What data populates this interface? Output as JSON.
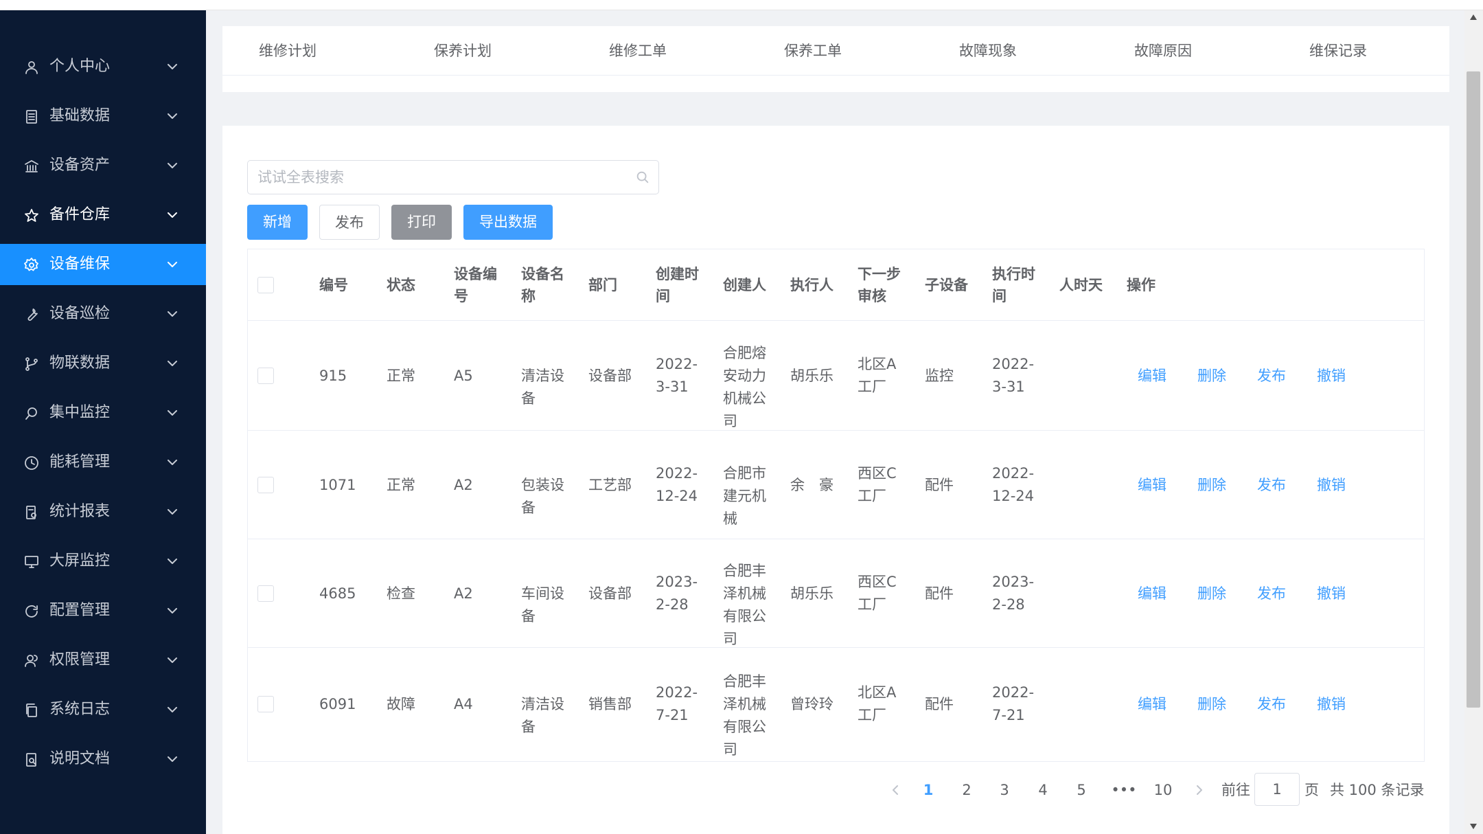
{
  "sidebar": {
    "items": [
      {
        "label": "个人中心",
        "icon": "user-icon"
      },
      {
        "label": "基础数据",
        "icon": "document-icon"
      },
      {
        "label": "设备资产",
        "icon": "bank-icon"
      },
      {
        "label": "备件仓库",
        "icon": "star-icon"
      },
      {
        "label": "设备维保",
        "icon": "gear-icon"
      },
      {
        "label": "设备巡检",
        "icon": "wrench-icon"
      },
      {
        "label": "物联数据",
        "icon": "branch-icon"
      },
      {
        "label": "集中监控",
        "icon": "search-monitor-icon"
      },
      {
        "label": "能耗管理",
        "icon": "clock-icon"
      },
      {
        "label": "统计报表",
        "icon": "report-icon"
      },
      {
        "label": "大屏监控",
        "icon": "monitor-icon"
      },
      {
        "label": "配置管理",
        "icon": "refresh-icon"
      },
      {
        "label": "权限管理",
        "icon": "users-icon"
      },
      {
        "label": "系统日志",
        "icon": "copy-icon"
      },
      {
        "label": "说明文档",
        "icon": "doc-search-icon"
      }
    ],
    "active_index": 4,
    "bright_index": 3,
    "bg_color": "#0b1a33",
    "active_color": "#1890ff"
  },
  "tabs": [
    "维修计划",
    "保养计划",
    "维修工单",
    "保养工单",
    "故障现象",
    "故障原因",
    "维保记录"
  ],
  "search": {
    "placeholder": "试试全表搜索",
    "value": ""
  },
  "toolbar": {
    "add_label": "新增",
    "publish_label": "发布",
    "print_label": "打印",
    "export_label": "导出数据"
  },
  "table": {
    "headers": [
      "编号",
      "状态",
      "设备编号",
      "设备名称",
      "部门",
      "创建时间",
      "创建人",
      "执行人",
      "下一步审核",
      "子设备",
      "执行时间",
      "人时天",
      "操作"
    ],
    "rows": [
      {
        "id": "915",
        "status": "正常",
        "code": "A5",
        "name": "清洁设备",
        "dept": "设备部",
        "created": "2022-3-31",
        "creator": "合肥熔安动力机械公司",
        "executor": "胡乐乐",
        "next": "北区A工厂",
        "sub": "监控",
        "exec_time": "2022-3-31",
        "man_days": ""
      },
      {
        "id": "1071",
        "status": "正常",
        "code": "A2",
        "name": "包装设备",
        "dept": "工艺部",
        "created": "2022-12-24",
        "creator": "合肥市建元机械",
        "executor": "余　豪",
        "next": "西区C工厂",
        "sub": "配件",
        "exec_time": "2022-12-24",
        "man_days": ""
      },
      {
        "id": "4685",
        "status": "检查",
        "code": "A2",
        "name": "车间设备",
        "dept": "设备部",
        "created": "2023-2-28",
        "creator": "合肥丰泽机械有限公司",
        "executor": "胡乐乐",
        "next": "西区C工厂",
        "sub": "配件",
        "exec_time": "2023-2-28",
        "man_days": ""
      },
      {
        "id": "6091",
        "status": "故障",
        "code": "A4",
        "name": "清洁设备",
        "dept": "销售部",
        "created": "2022-7-21",
        "creator": "合肥丰泽机械有限公司",
        "executor": "曾玲玲",
        "next": "北区A工厂",
        "sub": "配件",
        "exec_time": "2022-7-21",
        "man_days": ""
      }
    ],
    "actions": [
      "编辑",
      "删除",
      "发布",
      "撤销"
    ]
  },
  "pagination": {
    "pages": [
      "1",
      "2",
      "3",
      "4",
      "5",
      "•••",
      "10"
    ],
    "current": "1",
    "goto_prefix": "前往",
    "goto_value": "1",
    "goto_suffix": "页",
    "total": "共 100 条记录"
  },
  "colors": {
    "primary": "#409eff",
    "gray_button": "#909399",
    "link": "#409eff"
  }
}
